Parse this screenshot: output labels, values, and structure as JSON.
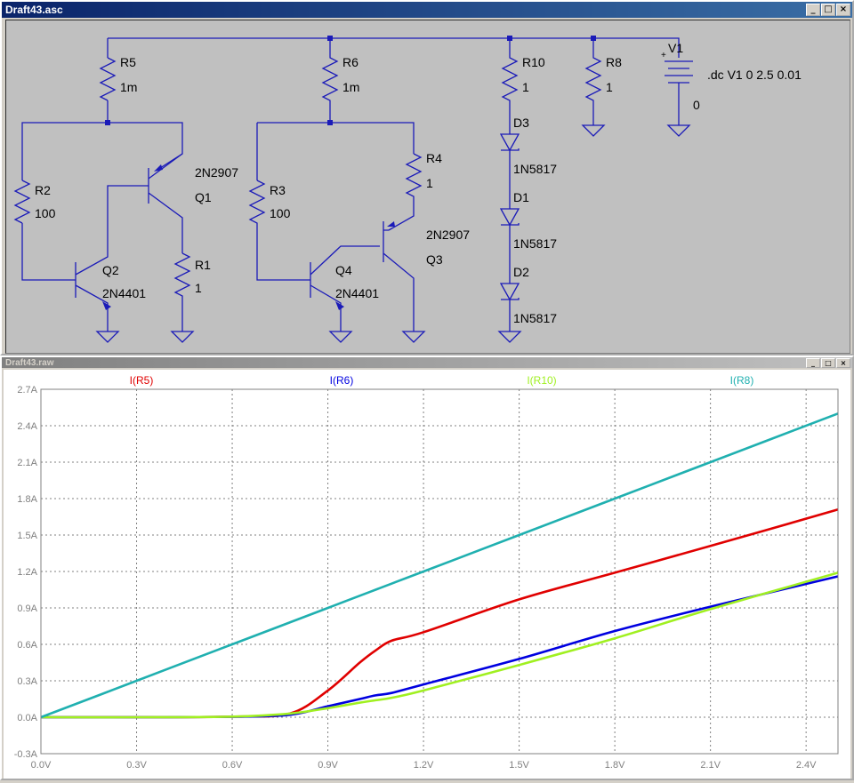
{
  "colors": {
    "wire": "#1b1bb8",
    "schematic_bg": "#c0c0c0",
    "plot_bg": "#ffffff",
    "grid": "#808080"
  },
  "schematic_window": {
    "title": "Draft43.asc",
    "buttons": {
      "minimize": "_",
      "maximize": "□",
      "close": "×"
    }
  },
  "waveform_window": {
    "title": "Draft43.raw",
    "buttons": {
      "minimize": "_",
      "maximize": "□",
      "close": "×"
    }
  },
  "components": {
    "R5": {
      "name": "R5",
      "value": "1m"
    },
    "R6": {
      "name": "R6",
      "value": "1m"
    },
    "R10": {
      "name": "R10",
      "value": "1"
    },
    "R8": {
      "name": "R8",
      "value": "1"
    },
    "R2": {
      "name": "R2",
      "value": "100"
    },
    "R3": {
      "name": "R3",
      "value": "100"
    },
    "R1": {
      "name": "R1",
      "value": "1"
    },
    "R4": {
      "name": "R4",
      "value": "1"
    },
    "Q1": {
      "name": "Q1",
      "model": "2N2907"
    },
    "Q2": {
      "name": "Q2",
      "model": "2N4401"
    },
    "Q3": {
      "name": "Q3",
      "model": "2N2907"
    },
    "Q4": {
      "name": "Q4",
      "model": "2N4401"
    },
    "D1": {
      "name": "D1",
      "model": "1N5817"
    },
    "D2": {
      "name": "D2",
      "model": "1N5817"
    },
    "D3": {
      "name": "D3",
      "model": "1N5817"
    },
    "V1": {
      "name": "V1",
      "value": "0",
      "plus": "+"
    }
  },
  "directive": ".dc V1 0 2.5 0.01",
  "chart_data": {
    "type": "line",
    "x": [
      0.0,
      0.3,
      0.6,
      0.78,
      0.9,
      1.0,
      1.05,
      1.1,
      1.2,
      1.5,
      1.8,
      2.1,
      2.5
    ],
    "x_tick_labels": [
      "0.0V",
      "0.3V",
      "0.6V",
      "0.9V",
      "1.2V",
      "1.5V",
      "1.8V",
      "2.1V",
      "2.4V"
    ],
    "y_tick_labels": [
      "2.7A",
      "2.4A",
      "2.1A",
      "1.8A",
      "1.5A",
      "1.2A",
      "0.9A",
      "0.6A",
      "0.3A",
      "0.0A",
      "-0.3A"
    ],
    "xlim": [
      0,
      2.5
    ],
    "ylim": [
      -0.3,
      2.7
    ],
    "grid": true,
    "series": [
      {
        "name": "I(R5)",
        "color": "#e00000",
        "values": [
          0.0,
          0.0,
          0.005,
          0.03,
          0.22,
          0.45,
          0.55,
          0.63,
          0.7,
          0.97,
          1.19,
          1.41,
          1.71
        ]
      },
      {
        "name": "I(R6)",
        "color": "#0000e0",
        "values": [
          0.0,
          0.0,
          0.003,
          0.02,
          0.09,
          0.15,
          0.18,
          0.2,
          0.27,
          0.48,
          0.71,
          0.91,
          1.16
        ]
      },
      {
        "name": "I(R10)",
        "color": "#a0f020",
        "values": [
          0.0,
          0.0,
          0.005,
          0.03,
          0.075,
          0.12,
          0.14,
          0.16,
          0.22,
          0.43,
          0.65,
          0.89,
          1.19
        ]
      },
      {
        "name": "I(R8)",
        "color": "#20b0b0",
        "values": [
          0.0,
          0.3,
          0.6,
          0.78,
          0.9,
          1.0,
          1.05,
          1.1,
          1.2,
          1.5,
          1.8,
          2.1,
          2.5
        ]
      }
    ]
  }
}
